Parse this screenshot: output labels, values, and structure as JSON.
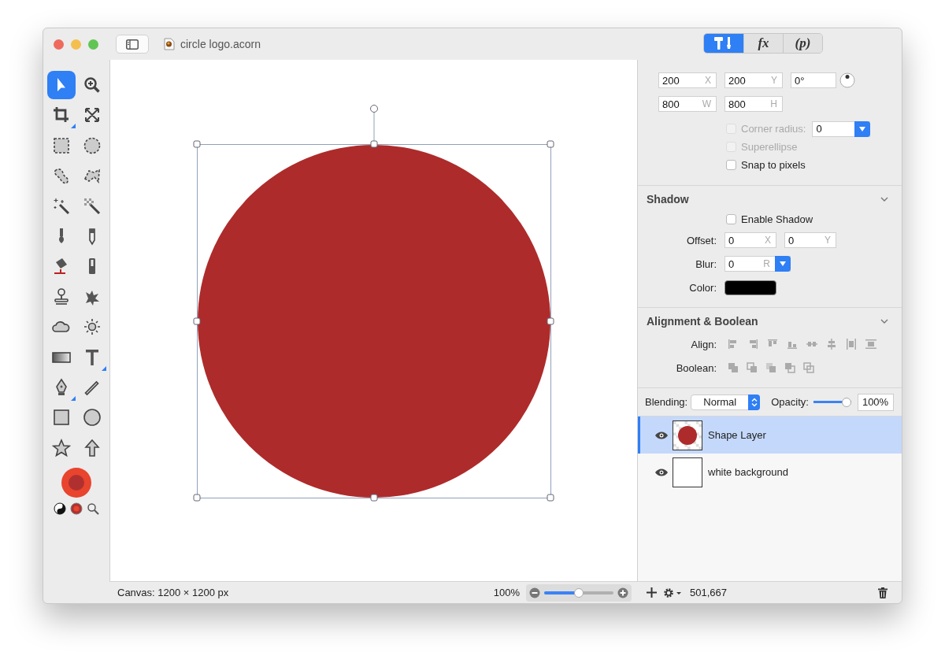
{
  "window": {
    "title": "circle logo.acorn"
  },
  "tools": [
    {
      "kind": "select",
      "selected": true,
      "submenu": false
    },
    {
      "kind": "zoom",
      "selected": false,
      "submenu": false
    },
    {
      "kind": "crop",
      "selected": false,
      "submenu": true
    },
    {
      "kind": "transform",
      "selected": false,
      "submenu": false
    },
    {
      "kind": "rect-select",
      "selected": false,
      "submenu": false
    },
    {
      "kind": "ellipse-select",
      "selected": false,
      "submenu": false
    },
    {
      "kind": "lasso",
      "selected": false,
      "submenu": false
    },
    {
      "kind": "polygon-lasso",
      "selected": false,
      "submenu": false
    },
    {
      "kind": "magic-wand",
      "selected": false,
      "submenu": false
    },
    {
      "kind": "checker-wand",
      "selected": false,
      "submenu": false
    },
    {
      "kind": "brush",
      "selected": false,
      "submenu": false
    },
    {
      "kind": "pencil",
      "selected": false,
      "submenu": false
    },
    {
      "kind": "bucket",
      "selected": false,
      "submenu": false
    },
    {
      "kind": "eraser",
      "selected": false,
      "submenu": false
    },
    {
      "kind": "stamp",
      "selected": false,
      "submenu": false
    },
    {
      "kind": "splatter",
      "selected": false,
      "submenu": false
    },
    {
      "kind": "cloud",
      "selected": false,
      "submenu": false
    },
    {
      "kind": "sun",
      "selected": false,
      "submenu": false
    },
    {
      "kind": "gradient",
      "selected": false,
      "submenu": false
    },
    {
      "kind": "text",
      "selected": false,
      "submenu": true
    },
    {
      "kind": "pen",
      "selected": false,
      "submenu": true
    },
    {
      "kind": "line",
      "selected": false,
      "submenu": false
    },
    {
      "kind": "square",
      "selected": false,
      "submenu": false
    },
    {
      "kind": "circle",
      "selected": false,
      "submenu": false
    },
    {
      "kind": "star",
      "selected": false,
      "submenu": false
    },
    {
      "kind": "arrow",
      "selected": false,
      "submenu": false
    }
  ],
  "canvas": {
    "shape": {
      "kind": "circle",
      "color": "#ae2b2b",
      "selected": true
    }
  },
  "status_bar": {
    "canvas_size": "Canvas: 1200 × 1200 px",
    "zoom": "100%",
    "zoom_slider": {
      "level": 0.5
    }
  },
  "inspector": {
    "tabs": [
      {
        "kind": "tools",
        "selected": true
      },
      {
        "kind": "text",
        "label": "fx",
        "selected": false
      },
      {
        "kind": "text",
        "label": "(p)",
        "selected": false
      }
    ],
    "geometry": {
      "rows": [
        [
          {
            "value": "200",
            "unit": "X"
          },
          {
            "value": "200",
            "unit": "Y"
          },
          {
            "value": "0°"
          }
        ],
        [
          {
            "value": "800",
            "unit": "W"
          },
          {
            "value": "800",
            "unit": "H"
          }
        ]
      ],
      "checkboxes": [
        {
          "label": "Corner radius:",
          "checked": false,
          "disabled": true
        },
        {
          "label": "Superellipse",
          "checked": false,
          "disabled": true
        },
        {
          "label": "Snap to pixels",
          "checked": false,
          "disabled": false
        }
      ],
      "corner_radius": "0"
    },
    "shadow": {
      "title": "Shadow",
      "expanded": true,
      "enable": {
        "label": "Enable Shadow",
        "checked": false
      },
      "offset_label": "Offset:",
      "offset_x": {
        "value": "0",
        "unit": "X"
      },
      "offset_y": {
        "value": "0",
        "unit": "Y"
      },
      "blur_label": "Blur:",
      "blur": {
        "value": "0",
        "unit": "R"
      },
      "color_label": "Color:",
      "color": "#000000"
    },
    "alignment": {
      "title": "Alignment & Boolean",
      "expanded": true,
      "align_label": "Align:",
      "boolean_label": "Boolean:"
    },
    "blending": {
      "label": "Blending:",
      "mode": "Normal",
      "opacity_label": "Opacity:",
      "opacity": {
        "level": 1
      },
      "opacity_value": "100%"
    },
    "layers": [
      {
        "name": "Shape Layer",
        "kind": "shape",
        "selected": true,
        "visible": true
      },
      {
        "name": "white background",
        "kind": "fill",
        "selected": false,
        "visible": true
      }
    ],
    "layer_footer": {
      "count": "501,667"
    }
  }
}
